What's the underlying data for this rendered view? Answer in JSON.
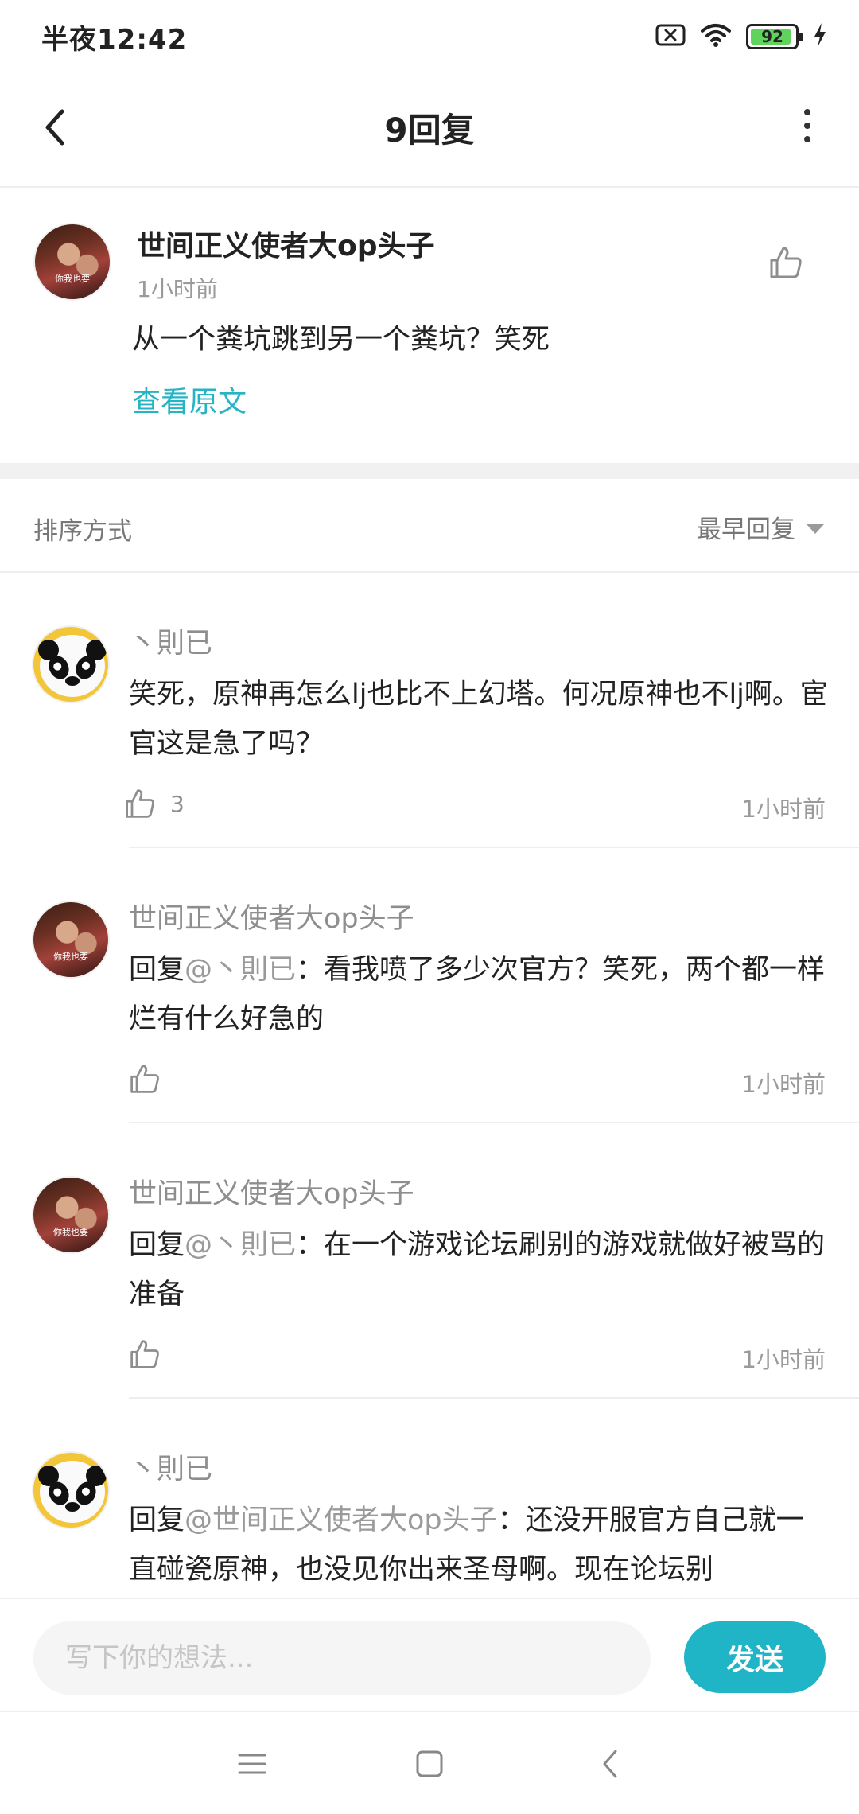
{
  "status_bar": {
    "time": "半夜12:42",
    "battery": "92",
    "battery_level": 0.92,
    "icons": [
      "sim-off-icon",
      "wifi-icon",
      "battery-icon",
      "charging-icon"
    ]
  },
  "header": {
    "title": "9回复",
    "back_icon": "back-arrow-icon",
    "more_icon": "more-vertical-icon"
  },
  "original": {
    "author": "世间正义使者大op头子",
    "time": "1小时前",
    "text": "从一个粪坑跳到另一个粪坑？笑死",
    "view_original": "查看原文",
    "avatar_caption": "你我也要"
  },
  "sort": {
    "label": "排序方式",
    "selected": "最早回复"
  },
  "replies": [
    {
      "author": "丶則已",
      "text": "笑死，原神再怎么lj也比不上幻塔。何况原神也不lj啊。宦官这是急了吗？",
      "likes": "3",
      "time": "1小时前"
    },
    {
      "author": "世间正义使者大op头子",
      "reply_prefix": "回复",
      "mention": "@丶則已",
      "text": "：看我喷了多少次官方？笑死，两个都一样烂有什么好急的",
      "time": "1小时前",
      "avatar_caption": "你我也要"
    },
    {
      "author": "世间正义使者大op头子",
      "reply_prefix": "回复",
      "mention": "@丶則已",
      "text": "：在一个游戏论坛刷别的游戏就做好被骂的准备",
      "time": "1小时前",
      "avatar_caption": "你我也要"
    },
    {
      "author": "丶則已",
      "reply_prefix": "回复",
      "mention": "@世间正义使者大op头子",
      "text": "：还没开服官方自己就一直碰瓷原神，也没见你出来圣母啊。现在论坛别"
    }
  ],
  "input": {
    "placeholder": "写下你的想法...",
    "send_label": "发送"
  },
  "colors": {
    "accent": "#1fb4c6",
    "link": "#26b3c4",
    "muted_text": "#9a9a9a"
  }
}
